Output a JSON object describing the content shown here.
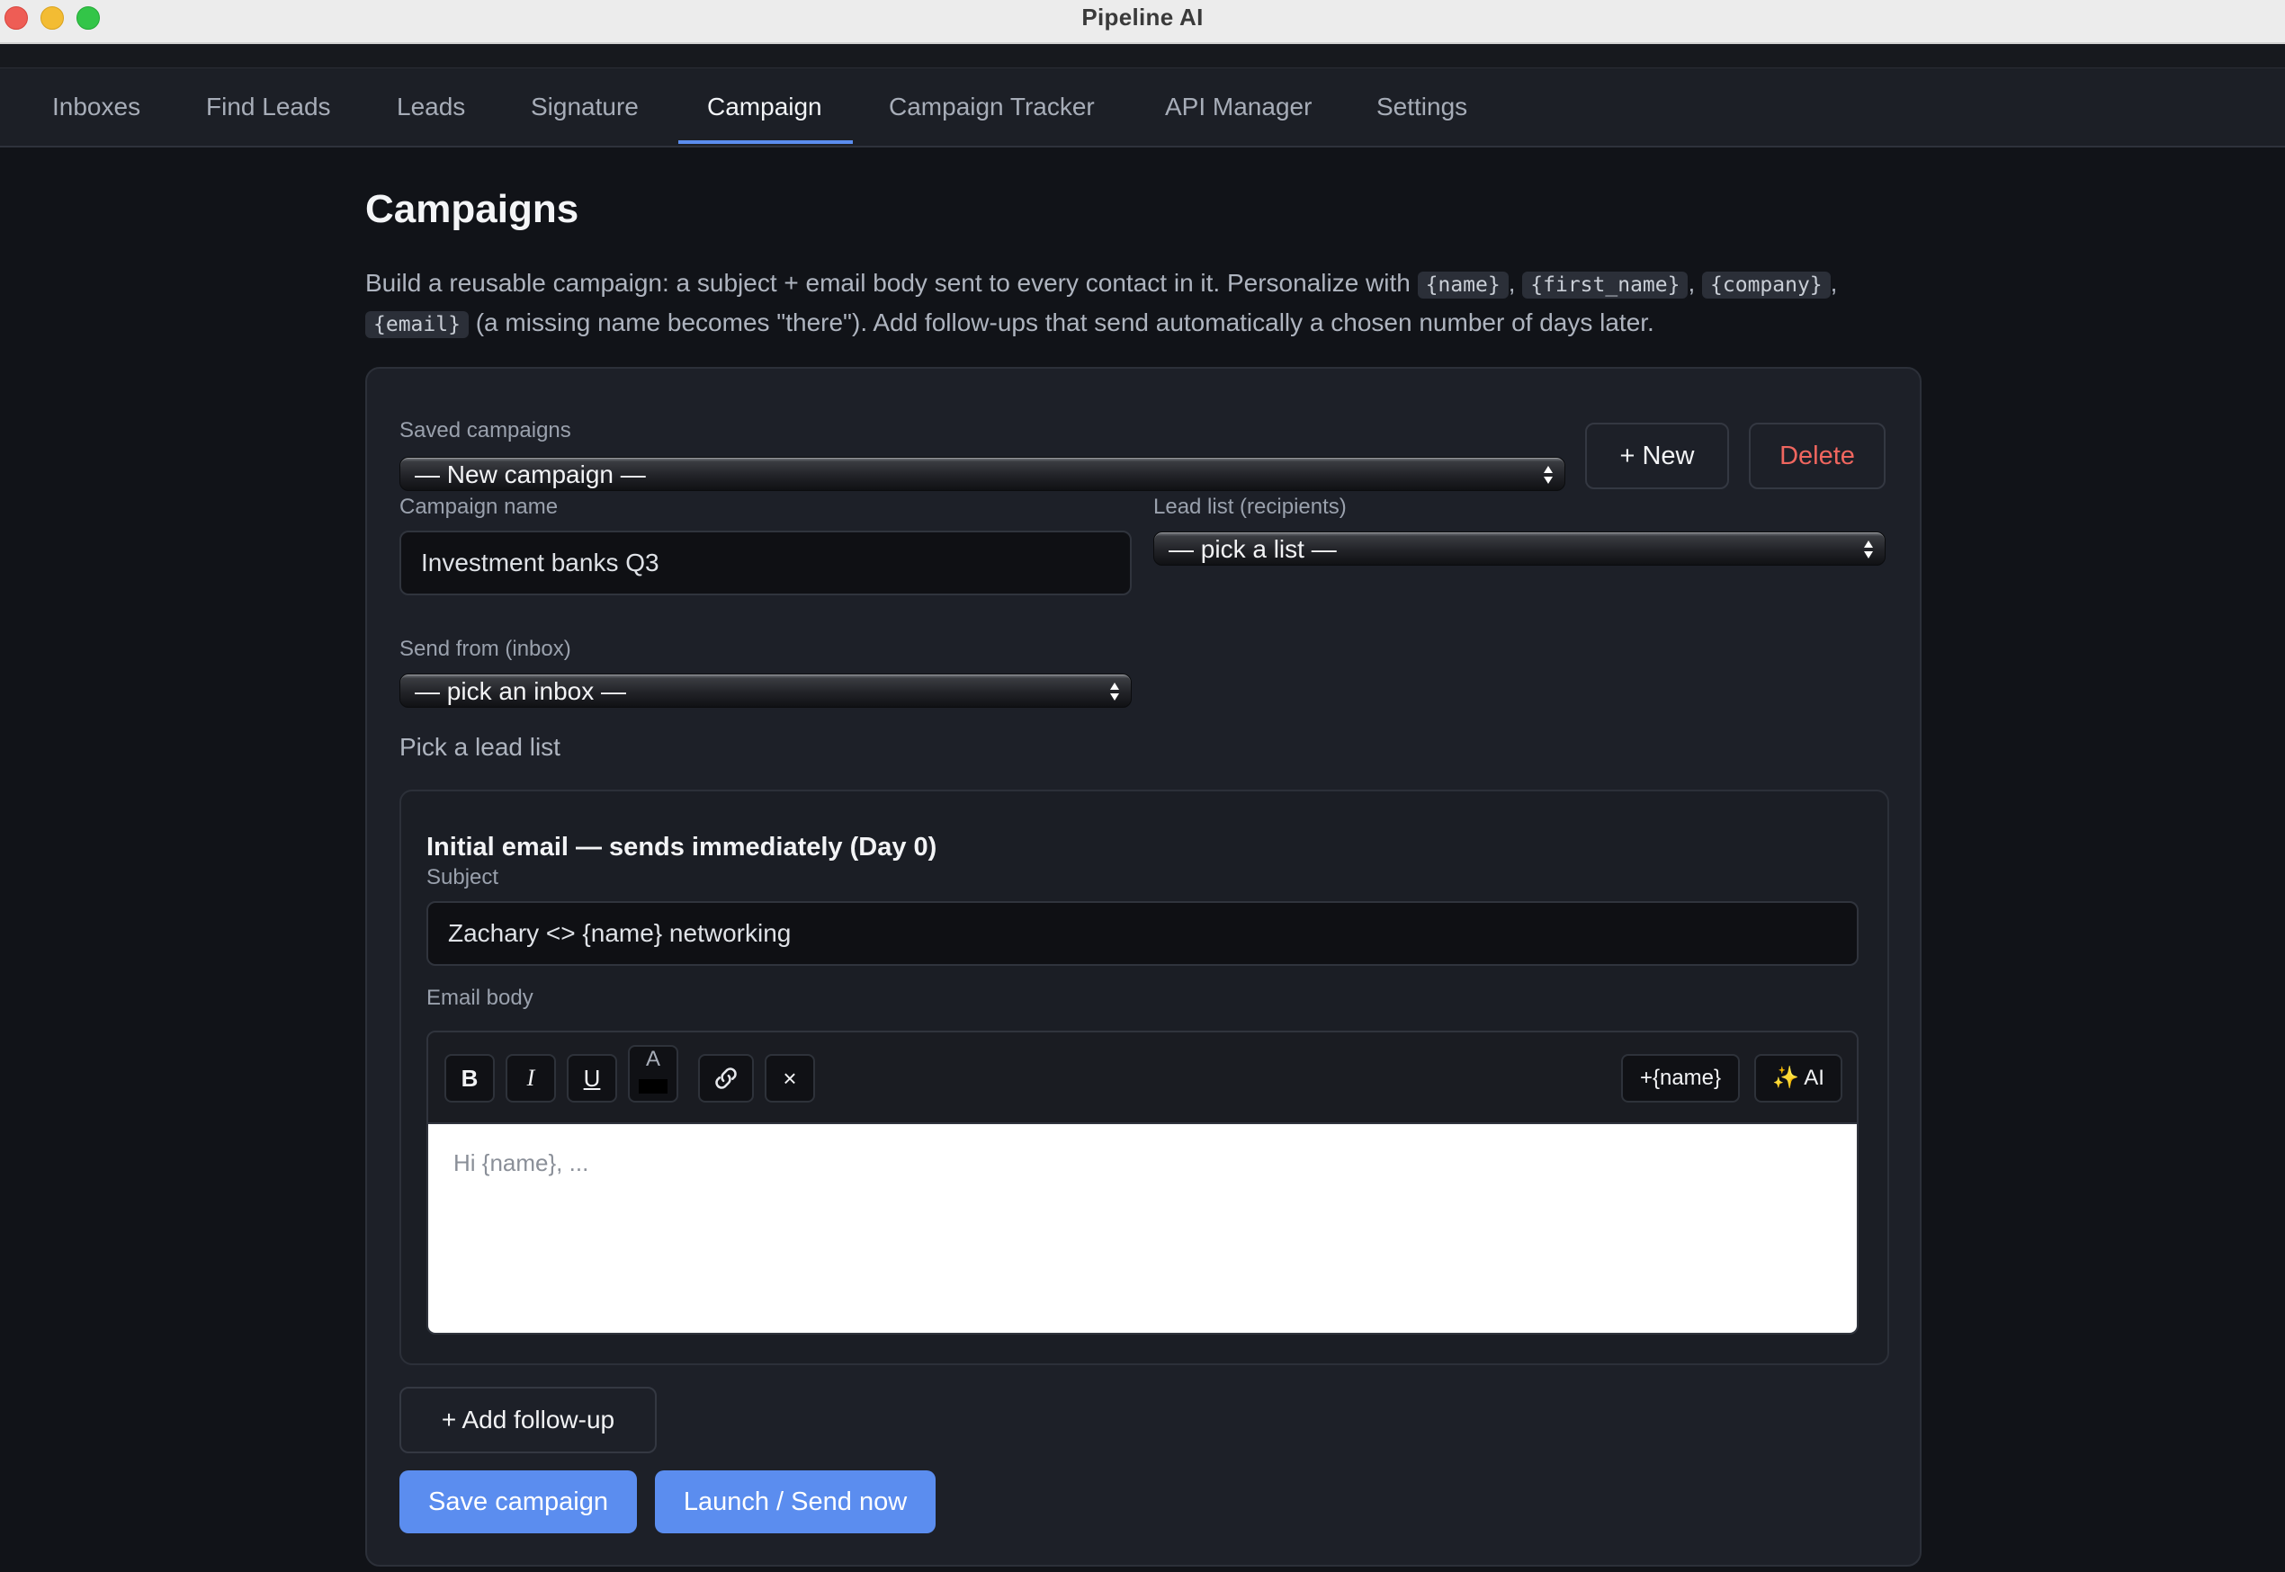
{
  "window": {
    "title": "Pipeline AI"
  },
  "nav": {
    "tabs": [
      {
        "label": "Inboxes"
      },
      {
        "label": "Find Leads"
      },
      {
        "label": "Leads"
      },
      {
        "label": "Signature"
      },
      {
        "label": "Campaign",
        "active": true
      },
      {
        "label": "Campaign Tracker"
      },
      {
        "label": "API Manager"
      },
      {
        "label": "Settings"
      }
    ]
  },
  "page": {
    "title": "Campaigns",
    "intro_prefix": "Build a reusable campaign: a subject + email body sent to every contact in it. Personalize with",
    "tokens": [
      "{name}",
      "{first_name}",
      "{company}",
      "{email}"
    ],
    "intro_suffix": "(a missing name becomes \"there\"). Add follow-ups that send automatically a chosen number of days later."
  },
  "campaign_form": {
    "saved_campaigns_label": "Saved campaigns",
    "saved_campaigns_value": "— New campaign —",
    "new_button": "+ New",
    "delete_button": "Delete",
    "campaign_name_label": "Campaign name",
    "campaign_name_value": "Investment banks Q3",
    "lead_list_label": "Lead list (recipients)",
    "lead_list_value": "— pick a list —",
    "send_from_label": "Send from (inbox)",
    "send_from_value": "— pick an inbox —",
    "hint": "Pick a lead list"
  },
  "initial_email": {
    "title": "Initial email — sends immediately (Day 0)",
    "subject_label": "Subject",
    "subject_value": "Zachary <> {name} networking",
    "body_label": "Email body",
    "body_placeholder": "Hi {name}, ...",
    "toolbar": {
      "bold": "B",
      "italic": "I",
      "underline": "U",
      "text_color": "A",
      "clear": "×",
      "insert_name": "+{name}",
      "ai": "AI"
    }
  },
  "actions": {
    "add_followup": "+ Add follow-up",
    "save": "Save campaign",
    "launch": "Launch / Send now"
  },
  "colors": {
    "accent": "#5b8def",
    "danger": "#f0665f",
    "background": "#111318",
    "card": "#1d2028"
  },
  "icons": [
    "link-icon",
    "sparkles-icon",
    "select-arrows-icon"
  ]
}
